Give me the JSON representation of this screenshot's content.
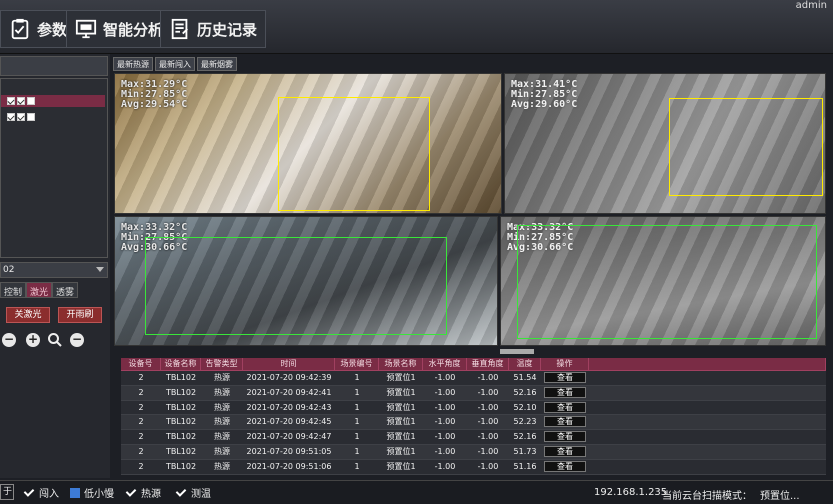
{
  "header": {
    "buttons": [
      {
        "label": "参数",
        "icon": "clipboard-check-icon"
      },
      {
        "label": "智能分析",
        "icon": "monitor-analysis-icon"
      },
      {
        "label": "历史记录",
        "icon": "history-doc-icon"
      }
    ],
    "user": "admin"
  },
  "left_panel": {
    "device_field": "02",
    "tabs": [
      "控制",
      "激光",
      "透雾"
    ],
    "active_tab": "激光",
    "laser_off_btn": "关激光",
    "laser_on_btn": "开雨刷",
    "zoom_out": "−",
    "zoom_in": "+",
    "zoom_out2": "−"
  },
  "video": {
    "tabs": [
      "最新热源",
      "最新闯入",
      "最新烟雾"
    ],
    "cams": [
      {
        "max": "Max:31.29°C",
        "min": "Min:27.85°C",
        "avg": "Avg:29.54°C",
        "roi_color": "#ffeb00"
      },
      {
        "max": "Max:31.41°C",
        "min": "Min:27.85°C",
        "avg": "Avg:29.60°C",
        "roi_color": "#ffeb00"
      },
      {
        "max": "Max:33.32°C",
        "min": "Min:27.85°C",
        "avg": "Avg:30.66°C",
        "roi_color": "#39e639"
      },
      {
        "max": "Max:33.32°C",
        "min": "Min:27.85°C",
        "avg": "Avg:30.66°C",
        "roi_color": "#39e639"
      }
    ]
  },
  "table": {
    "columns": [
      "设备号",
      "设备名称",
      "告警类型",
      "时间",
      "场景编号",
      "场景名称",
      "水平角度",
      "垂直角度",
      "温度",
      "操作"
    ],
    "rows": [
      [
        "2",
        "TBL102",
        "热源",
        "2021-07-20 09:42:39",
        "1",
        "预置位1",
        "-1.00",
        "-1.00",
        "51.54",
        "查看"
      ],
      [
        "2",
        "TBL102",
        "热源",
        "2021-07-20 09:42:41",
        "1",
        "预置位1",
        "-1.00",
        "-1.00",
        "52.16",
        "查看"
      ],
      [
        "2",
        "TBL102",
        "热源",
        "2021-07-20 09:42:43",
        "1",
        "预置位1",
        "-1.00",
        "-1.00",
        "52.10",
        "查看"
      ],
      [
        "2",
        "TBL102",
        "热源",
        "2021-07-20 09:42:45",
        "1",
        "预置位1",
        "-1.00",
        "-1.00",
        "52.23",
        "查看"
      ],
      [
        "2",
        "TBL102",
        "热源",
        "2021-07-20 09:42:47",
        "1",
        "预置位1",
        "-1.00",
        "-1.00",
        "52.16",
        "查看"
      ],
      [
        "2",
        "TBL102",
        "热源",
        "2021-07-20 09:51:05",
        "1",
        "预置位1",
        "-1.00",
        "-1.00",
        "51.73",
        "查看"
      ],
      [
        "2",
        "TBL102",
        "热源",
        "2021-07-20 09:51:06",
        "1",
        "预置位1",
        "-1.00",
        "-1.00",
        "51.16",
        "查看"
      ]
    ]
  },
  "status": {
    "left_label": "于",
    "items": [
      "闯入",
      "低小慢",
      "热源",
      "测温"
    ],
    "ip": "192.168.1.235",
    "mode_label": "当前云台扫描模式：",
    "mode_value": "预置位..."
  }
}
